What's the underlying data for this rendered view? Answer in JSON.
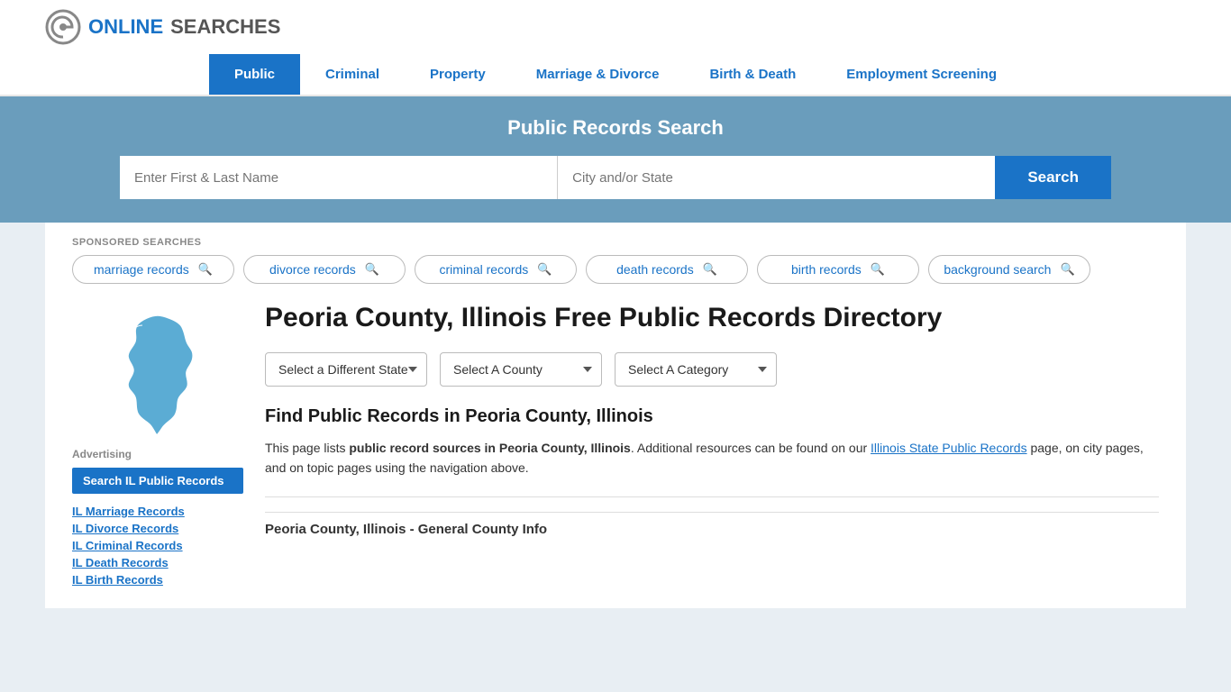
{
  "site": {
    "logo_text_online": "ONLINE",
    "logo_text_searches": "SEARCHES"
  },
  "nav": {
    "items": [
      {
        "label": "Public",
        "active": true
      },
      {
        "label": "Criminal",
        "active": false
      },
      {
        "label": "Property",
        "active": false
      },
      {
        "label": "Marriage & Divorce",
        "active": false
      },
      {
        "label": "Birth & Death",
        "active": false
      },
      {
        "label": "Employment Screening",
        "active": false
      }
    ]
  },
  "search_banner": {
    "title": "Public Records Search",
    "name_placeholder": "Enter First & Last Name",
    "city_placeholder": "City and/or State",
    "button_label": "Search"
  },
  "sponsored": {
    "label": "SPONSORED SEARCHES",
    "pills": [
      {
        "label": "marriage records"
      },
      {
        "label": "divorce records"
      },
      {
        "label": "criminal records"
      },
      {
        "label": "death records"
      },
      {
        "label": "birth records"
      },
      {
        "label": "background search"
      }
    ]
  },
  "page": {
    "title": "Peoria County, Illinois Free Public Records Directory",
    "dropdowns": {
      "state": "Select a Different State",
      "county": "Select A County",
      "category": "Select A Category"
    },
    "find_title": "Find Public Records in Peoria County, Illinois",
    "find_description_prefix": "This page lists ",
    "find_description_bold": "public record sources in Peoria County, Illinois",
    "find_description_mid": ". Additional resources can be found on our ",
    "find_description_link": "Illinois State Public Records",
    "find_description_suffix": " page, on city pages, and on topic pages using the navigation above.",
    "general_info_title": "Peoria County, Illinois - General County Info"
  },
  "sidebar": {
    "advertising_label": "Advertising",
    "ad_button": "Search IL Public Records",
    "links": [
      "IL Marriage Records",
      "IL Divorce Records",
      "IL Criminal Records",
      "IL Death Records",
      "IL Birth Records"
    ]
  }
}
